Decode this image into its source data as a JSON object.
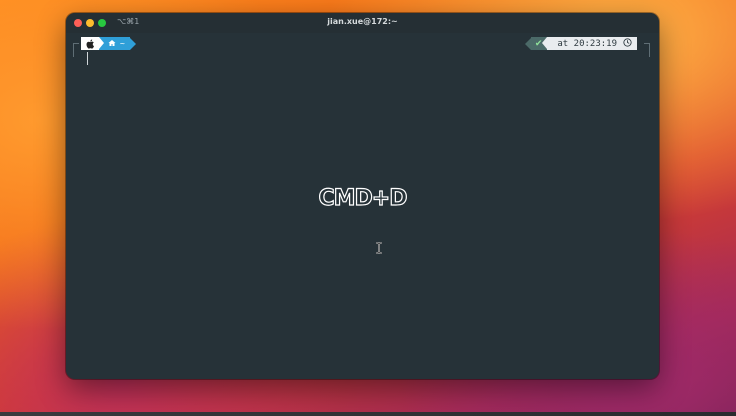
{
  "window": {
    "title": "jian.xue@172:~",
    "shortcut": "⌥⌘1"
  },
  "prompt": {
    "os_icon": "apple-icon",
    "dir_icon": "home-icon",
    "dir": "~",
    "status_icon": "checkmark-icon",
    "time_text": "at 20:23:19",
    "time_icon": "clock-icon"
  },
  "overlay": {
    "text": "CMD+D"
  },
  "colors": {
    "terminal_bg": "#263238",
    "dir_segment": "#2f9fd8",
    "status_segment": "#4b6a68",
    "time_segment": "#e9ecef"
  }
}
